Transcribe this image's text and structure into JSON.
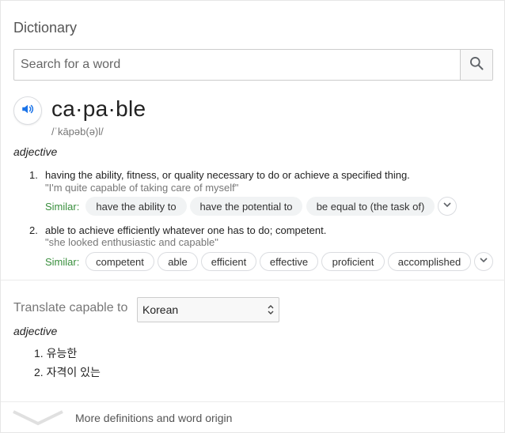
{
  "header": {
    "title": "Dictionary"
  },
  "search": {
    "placeholder": "Search for a word",
    "value": ""
  },
  "entry": {
    "word": "ca·pa·ble",
    "phonetic": "/ˈkāpəb(ə)l/",
    "part_of_speech": "adjective",
    "senses": [
      {
        "number": "1.",
        "definition": "having the ability, fitness, or quality necessary to do or achieve a specified thing.",
        "example": "\"I'm quite capable of taking care of myself\"",
        "similar_label": "Similar:",
        "similar": [
          "have the ability to",
          "have the potential to",
          "be equal to (the task of)"
        ]
      },
      {
        "number": "2.",
        "definition": "able to achieve efficiently whatever one has to do; competent.",
        "example": "\"she looked enthusiastic and capable\"",
        "similar_label": "Similar:",
        "similar": [
          "competent",
          "able",
          "efficient",
          "effective",
          "proficient",
          "accomplished"
        ]
      }
    ]
  },
  "translate": {
    "label": "Translate capable to",
    "language": "Korean",
    "part_of_speech": "adjective",
    "items": [
      "1. 유능한",
      "2. 자격이 있는"
    ]
  },
  "footer": {
    "more_label": "More definitions and word origin"
  },
  "icons": {
    "search": "search-icon",
    "speaker": "speaker-icon",
    "expand": "chevron-down-icon"
  },
  "colors": {
    "accent_blue": "#1a73e8",
    "similar_green": "#388e3c"
  }
}
